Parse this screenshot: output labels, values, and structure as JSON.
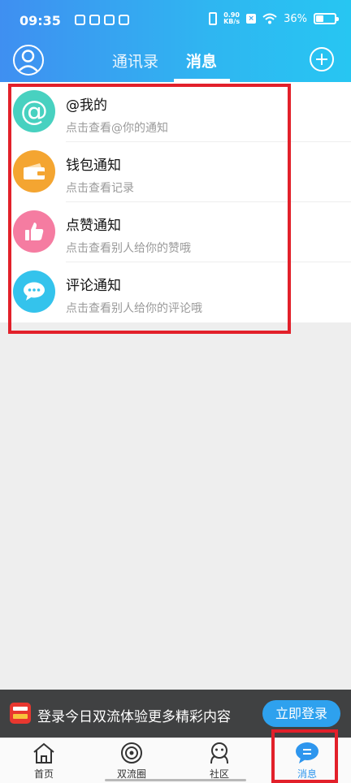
{
  "status_bar": {
    "time": "09:35",
    "speed": "0.90\nKB/s",
    "battery": "36%"
  },
  "header": {
    "tabs": [
      {
        "label": "通讯录"
      },
      {
        "label": "消息"
      }
    ]
  },
  "messages": [
    {
      "title": "@我的",
      "subtitle": "点击查看@你的通知",
      "icon": "at-icon",
      "color": "#48d1c0"
    },
    {
      "title": "钱包通知",
      "subtitle": "点击查看记录",
      "icon": "wallet-icon",
      "color": "#f4a531"
    },
    {
      "title": "点赞通知",
      "subtitle": "点击查看别人给你的赞哦",
      "icon": "thumbs-up-icon",
      "color": "#f57ca1"
    },
    {
      "title": "评论通知",
      "subtitle": "点击查看别人给你的评论哦",
      "icon": "comment-icon",
      "color": "#34c3ec"
    }
  ],
  "login_banner": {
    "text": "登录今日双流体验更多精彩内容",
    "button": "立即登录"
  },
  "tabbar": {
    "items": [
      {
        "label": "首页",
        "icon": "home-icon"
      },
      {
        "label": "双流圈",
        "icon": "circle-icon"
      },
      {
        "label": "社区",
        "icon": "community-icon"
      },
      {
        "label": "消息",
        "icon": "message-icon"
      }
    ],
    "active": 3
  },
  "colors": {
    "header_start": "#3f8ff1",
    "header_end": "#27c6f2",
    "highlight": "#e2202a",
    "accent": "#2ea1ee"
  }
}
